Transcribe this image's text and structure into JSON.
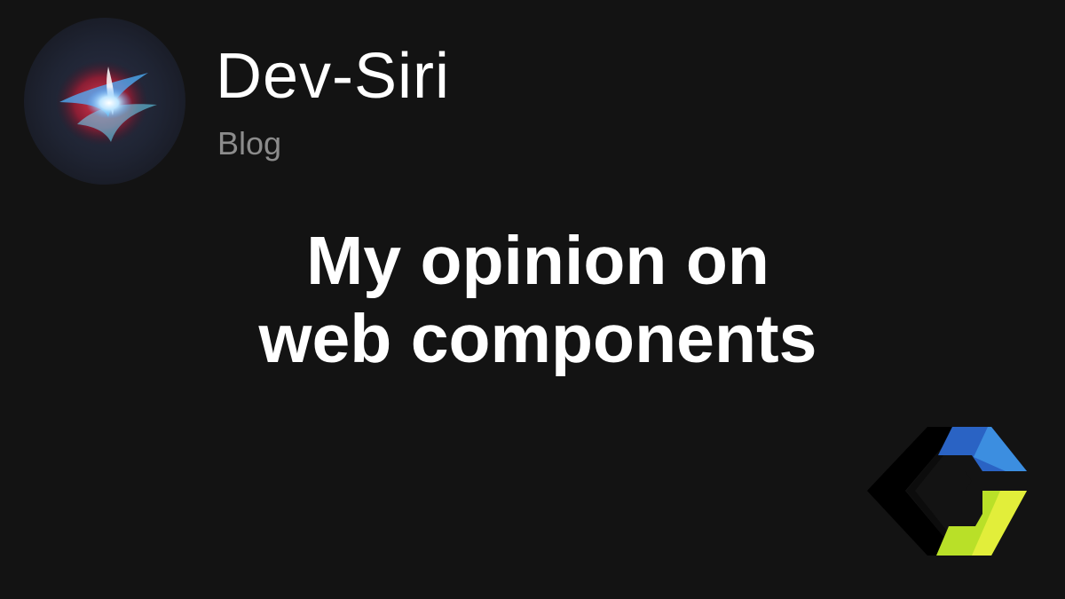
{
  "brand": {
    "name": "Dev-Siri",
    "subtitle": "Blog",
    "avatar_icon": "siri-orb-icon"
  },
  "headline": {
    "line1": "My opinion on",
    "line2": "web components"
  },
  "logo": {
    "icon": "web-components-logo-icon",
    "colors": {
      "dark": "#000000",
      "blue": "#2a63c4",
      "blue_light": "#3c8ee0",
      "green": "#b9e028",
      "green_light": "#e2ee3a"
    }
  },
  "colors": {
    "background": "#131313",
    "title": "#ffffff",
    "subtitle": "#8c8c8c"
  }
}
